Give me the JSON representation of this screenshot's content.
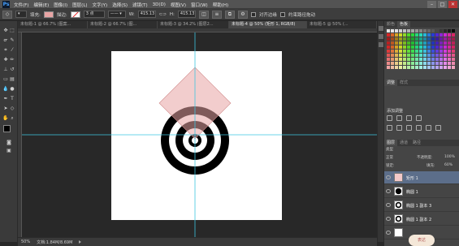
{
  "app": {
    "logo": "Ps"
  },
  "menubar": {
    "items": [
      "文件(F)",
      "编辑(E)",
      "图像(I)",
      "图层(L)",
      "文字(Y)",
      "选择(S)",
      "滤镜(T)",
      "3D(D)",
      "视图(V)",
      "窗口(W)",
      "帮助(H)"
    ],
    "window_buttons": [
      "–",
      "□",
      "✕"
    ]
  },
  "options": {
    "fill_label": "填充:",
    "stroke_label": "描边:",
    "stroke_width": "3 点",
    "w_label": "W:",
    "w_value": "415.13",
    "h_label": "H:",
    "h_value": "415.13",
    "align_edges": "对齐边缘",
    "constrain_path": "约束路径拖动",
    "fill_color": "#e8a4a4"
  },
  "tabs": [
    {
      "label": "未标题-1 @ 66.7% (图案...",
      "active": false
    },
    {
      "label": "未标题-2 @ 66.7% (图...",
      "active": false
    },
    {
      "label": "未标题-3 @ 34.2% (图层2...",
      "active": false
    },
    {
      "label": "未标题-4 @ 50% (矩形 1, RGB/8)",
      "active": true
    },
    {
      "label": "未标题-5 @ 50% (...",
      "active": false
    }
  ],
  "status": {
    "zoom": "50%",
    "doc": "文档:1.84M/8.69M"
  },
  "panels": {
    "swatch_tabs": [
      "颜色",
      "色板"
    ],
    "adjust_tabs": [
      "调整",
      "样式"
    ],
    "adjust_label": "添加调整",
    "layers_tabs": [
      "图层",
      "通道",
      "路径"
    ],
    "kind_label": "类型",
    "blend_mode": "正常",
    "opacity_label": "不透明度:",
    "opacity_value": "100%",
    "lock_label": "锁定:",
    "fill_label": "填充:",
    "fill_value": "60%",
    "layers": [
      {
        "name": "矩形 1",
        "selected": true
      },
      {
        "name": "椭圆 1",
        "selected": false
      },
      {
        "name": "椭圆 1 副本 3",
        "selected": false
      },
      {
        "name": "椭圆 1 副本 2",
        "selected": false
      },
      {
        "name": "",
        "selected": false
      }
    ],
    "watermark": "表达"
  },
  "colors": {
    "ps_blue": "#4aa3ff",
    "diamond_fill": "#e8a4a4",
    "guide": "#3ec6e0",
    "selected_layer": "#5c6e8a"
  }
}
